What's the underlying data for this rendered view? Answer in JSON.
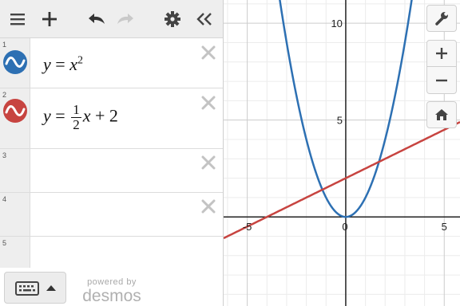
{
  "app": {
    "name": "Desmos graphing calculator"
  },
  "toolbar": {
    "menu_icon": "hamburger-menu-icon",
    "add_icon": "plus-icon",
    "undo_icon": "undo-icon",
    "redo_icon": "redo-icon",
    "settings_icon": "gear-icon",
    "collapse_icon": "double-chevron-left-icon"
  },
  "expressions": [
    {
      "index": "1",
      "latex": "y = x^2",
      "color": "#2d70b3",
      "visible": true
    },
    {
      "index": "2",
      "latex": "y = \\frac{1}{2}x + 2",
      "color": "#c74440",
      "visible": true
    },
    {
      "index": "3",
      "latex": "",
      "visible": false
    },
    {
      "index": "4",
      "latex": "",
      "visible": false
    },
    {
      "index": "5",
      "latex": "",
      "visible": false
    }
  ],
  "math_text": {
    "e1": {
      "y": "y",
      "eq": "=",
      "x": "x",
      "exp": "2"
    },
    "e2": {
      "y": "y",
      "eq": "=",
      "num": "1",
      "den": "2",
      "x": "x",
      "plus": "+",
      "c": "2"
    }
  },
  "bottom": {
    "keyboard_icon": "keyboard-icon",
    "caret_icon": "caret-up-icon",
    "powered_by": "powered by",
    "brand": "desmos"
  },
  "graph_controls": {
    "wrench_icon": "wrench-icon",
    "zoom_in_icon": "plus-icon",
    "zoom_out_icon": "minus-icon",
    "home_icon": "home-icon"
  },
  "axes": {
    "x_ticks": [
      "-5",
      "0",
      "5"
    ],
    "y_ticks": [
      "5",
      "10"
    ],
    "x_range": [
      -6.2,
      5.8
    ],
    "y_range": [
      -4.6,
      11.2
    ]
  },
  "chart_data": {
    "type": "line",
    "series": [
      {
        "latex": "y = x^2",
        "color": "#2d70b3",
        "function": "x^2"
      },
      {
        "latex": "y = 1/2 x + 2",
        "color": "#c74440",
        "function": "0.5x + 2"
      }
    ],
    "xlim": [
      -6.2,
      5.8
    ],
    "ylim": [
      -4.6,
      11.2
    ],
    "x_tick_labels": [
      "-5",
      "0",
      "5"
    ],
    "y_tick_labels": [
      "5",
      "10"
    ],
    "grid": true
  }
}
